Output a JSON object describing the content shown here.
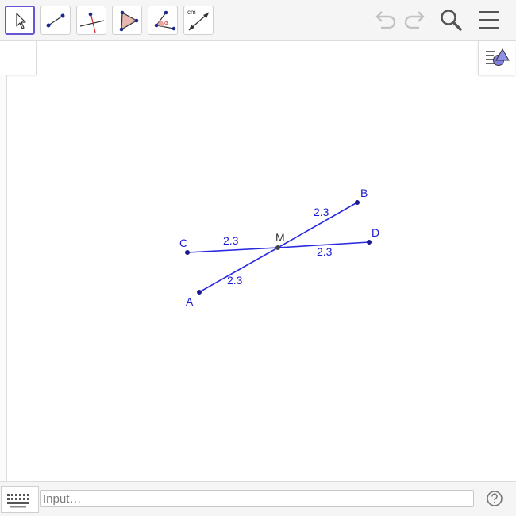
{
  "toolbar": {
    "tools": [
      {
        "id": "move",
        "icon": "move-arrow-icon",
        "active": true
      },
      {
        "id": "segment",
        "icon": "segment-icon"
      },
      {
        "id": "perpendicular",
        "icon": "perpendicular-line-icon"
      },
      {
        "id": "polygon",
        "icon": "polygon-icon"
      },
      {
        "id": "angle",
        "icon": "angle-icon"
      },
      {
        "id": "distance",
        "icon": "distance-icon",
        "label": "cm"
      }
    ],
    "undo_icon": "undo-icon",
    "redo_icon": "redo-icon",
    "search_icon": "search-icon",
    "menu_icon": "menu-icon"
  },
  "graphics": {
    "points": [
      {
        "name": "A",
        "label": "A"
      },
      {
        "name": "B",
        "label": "B"
      },
      {
        "name": "C",
        "label": "C"
      },
      {
        "name": "D",
        "label": "D"
      },
      {
        "name": "M",
        "label": "M"
      }
    ],
    "segment_labels": {
      "AM": "2.3",
      "MB": "2.3",
      "CM": "2.3",
      "MD": "2.3"
    },
    "colors": {
      "segment": "#2a2ae0",
      "point": "#1a1a8c",
      "label": "#1b1bd6",
      "midpoint": "#444444"
    }
  },
  "input": {
    "placeholder": "Input…"
  },
  "help_icon": "help-icon"
}
